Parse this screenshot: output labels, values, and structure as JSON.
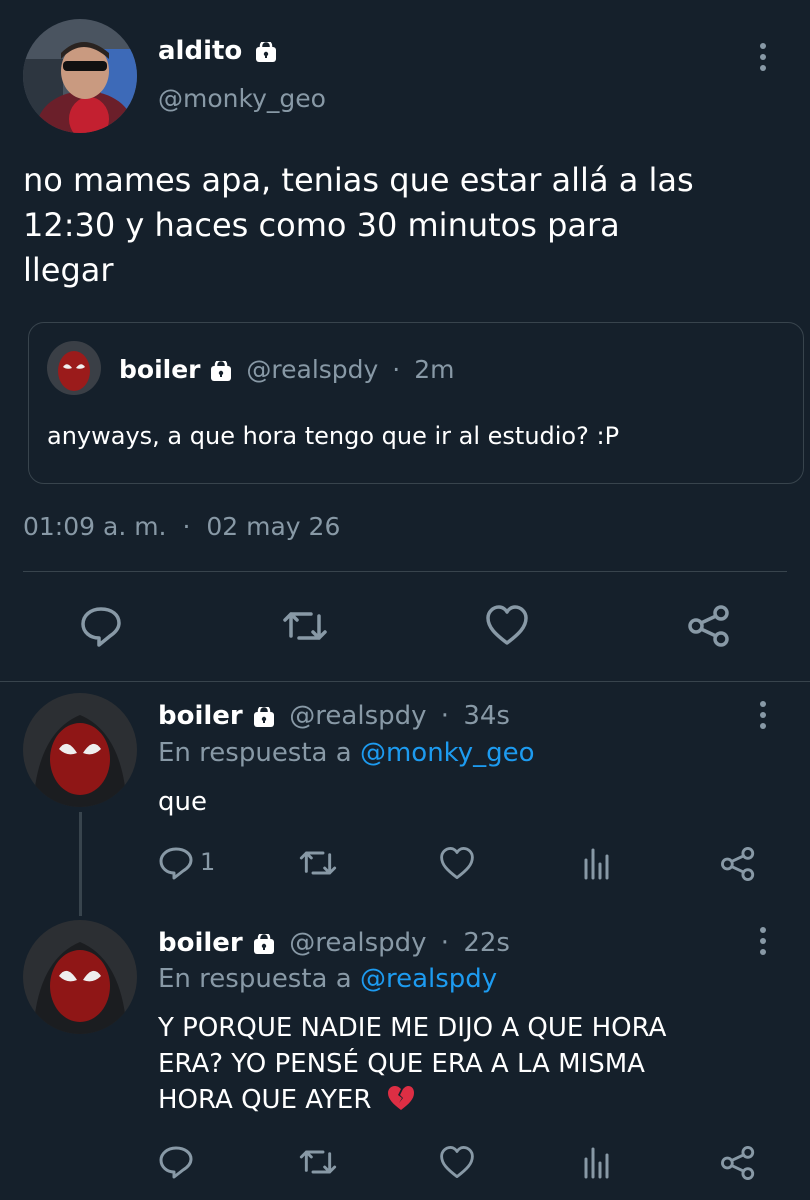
{
  "main_tweet": {
    "display_name": "aldito",
    "handle": "@monky_geo",
    "text_line1": "no mames apa, tenias que estar allá a las",
    "text_line2": "12:30 y haces como 30 minutos para",
    "text_line3": "llegar",
    "quote": {
      "display_name": "boiler",
      "handle": "@realspdy",
      "sep": "·",
      "time": "2m",
      "text": "anyways, a que hora tengo que ir al estudio? :P"
    },
    "timestamp_time": "01:09 a. m.",
    "timestamp_sep": "·",
    "timestamp_date": "02 may 26"
  },
  "replies": [
    {
      "display_name": "boiler",
      "handle": "@realspdy",
      "sep": "·",
      "time": "34s",
      "reply_prefix": "En respuesta a",
      "reply_to": "@monky_geo",
      "text_line1": "que",
      "reply_count": "1"
    },
    {
      "display_name": "boiler",
      "handle": "@realspdy",
      "sep": "·",
      "time": "22s",
      "reply_prefix": "En respuesta a",
      "reply_to": "@realspdy",
      "text_line1": "Y PORQUE NADIE ME DIJO A QUE HORA",
      "text_line2": "ERA? YO PENSÉ QUE ERA A LA MISMA",
      "text_line3": "HORA QUE AYER",
      "emoji": "💔"
    }
  ],
  "colors": {
    "background": "#15202b",
    "text": "#ffffff",
    "muted": "#8899a6",
    "link": "#1d9bf0",
    "divider": "#38444d"
  },
  "icons": [
    "lock-icon",
    "more-vert-icon",
    "reply-icon",
    "retweet-icon",
    "like-icon",
    "share-icon",
    "analytics-icon",
    "broken-heart-emoji"
  ]
}
